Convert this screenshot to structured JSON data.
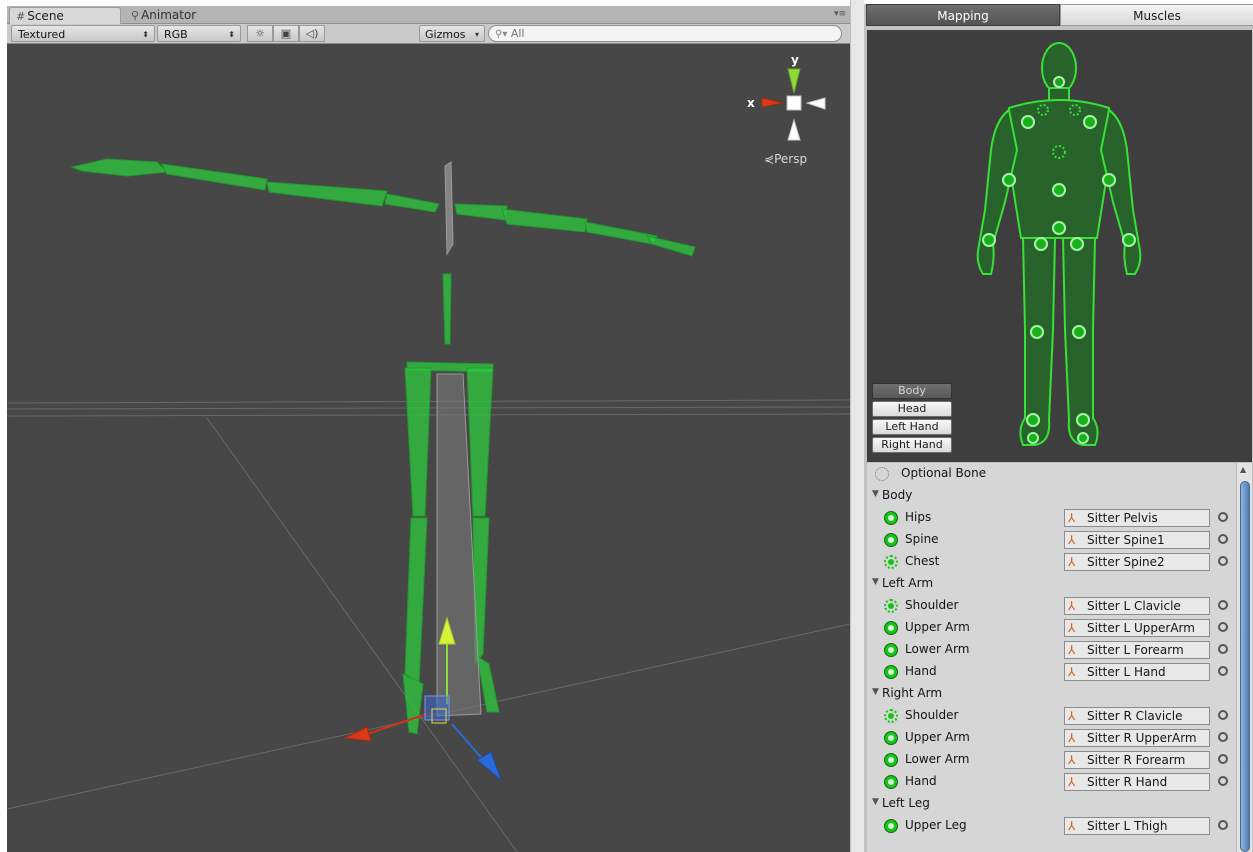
{
  "scene_window": {
    "tabs": [
      {
        "icon": "grid-icon",
        "label": "Scene"
      },
      {
        "icon": "animator-icon",
        "label": "Animator"
      }
    ],
    "toolbar": {
      "draw_mode": "Textured",
      "render_mode": "RGB",
      "gizmos_label": "Gizmos",
      "search_placeholder": "All"
    },
    "view_gizmo": {
      "y_label": "y",
      "x_label": "x",
      "projection_label": "Persp"
    },
    "colors": {
      "background": "#474747",
      "bone_green": "#28c43a",
      "axis_red": "#d33018",
      "axis_green": "#8cdc38",
      "axis_blue": "#2a6ad8"
    }
  },
  "avatar_panel": {
    "tabs": {
      "mapping": "Mapping",
      "muscles": "Muscles"
    },
    "body_part_buttons": [
      "Body",
      "Head",
      "Left Hand",
      "Right Hand"
    ],
    "optional_bone_label": "Optional Bone",
    "sections": [
      {
        "name": "Body",
        "bones": [
          {
            "label": "Hips",
            "target": "Sitter Pelvis",
            "required": true
          },
          {
            "label": "Spine",
            "target": "Sitter Spine1",
            "required": true
          },
          {
            "label": "Chest",
            "target": "Sitter Spine2",
            "required": false
          }
        ]
      },
      {
        "name": "Left Arm",
        "bones": [
          {
            "label": "Shoulder",
            "target": "Sitter L Clavicle",
            "required": false
          },
          {
            "label": "Upper Arm",
            "target": "Sitter L UpperArm",
            "required": true
          },
          {
            "label": "Lower Arm",
            "target": "Sitter L Forearm",
            "required": true
          },
          {
            "label": "Hand",
            "target": "Sitter L Hand",
            "required": true
          }
        ]
      },
      {
        "name": "Right Arm",
        "bones": [
          {
            "label": "Shoulder",
            "target": "Sitter R Clavicle",
            "required": false
          },
          {
            "label": "Upper Arm",
            "target": "Sitter R UpperArm",
            "required": true
          },
          {
            "label": "Lower Arm",
            "target": "Sitter R Forearm",
            "required": true
          },
          {
            "label": "Hand",
            "target": "Sitter R Hand",
            "required": true
          }
        ]
      },
      {
        "name": "Left Leg",
        "bones": [
          {
            "label": "Upper Leg",
            "target": "Sitter L Thigh",
            "required": true
          }
        ]
      }
    ],
    "colors": {
      "mapped": "#17c51a",
      "selected_tab": "#5e5e5e",
      "scroll_thumb": "#5b8bc0"
    }
  }
}
